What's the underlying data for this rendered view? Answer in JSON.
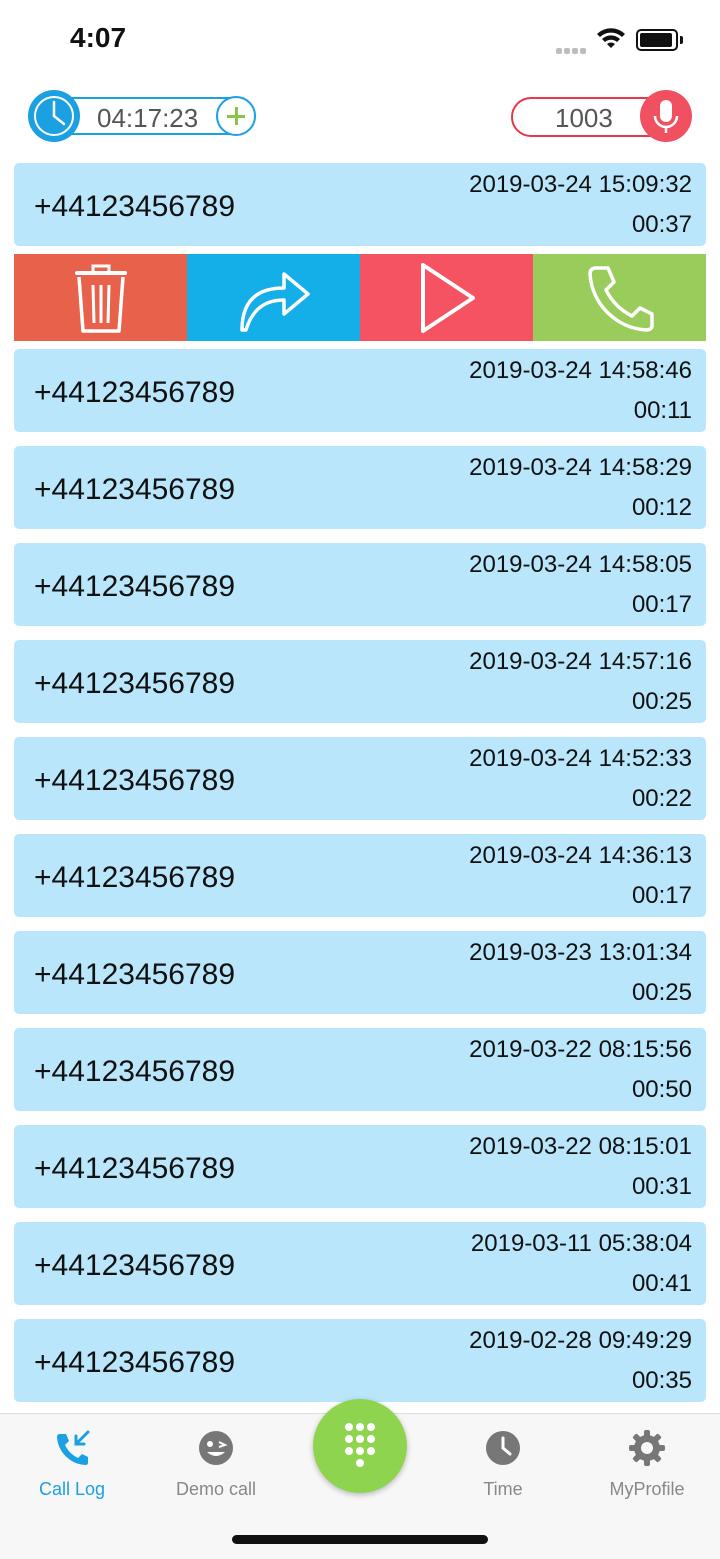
{
  "status_bar": {
    "time": "4:07"
  },
  "header": {
    "balance": "04:17:23",
    "extension": "1003"
  },
  "calls": [
    {
      "number": "+44123456789",
      "datetime": "2019-03-24 15:09:32",
      "duration": "00:37"
    },
    {
      "number": "+44123456789",
      "datetime": "2019-03-24 14:58:46",
      "duration": "00:11"
    },
    {
      "number": "+44123456789",
      "datetime": "2019-03-24 14:58:29",
      "duration": "00:12"
    },
    {
      "number": "+44123456789",
      "datetime": "2019-03-24 14:58:05",
      "duration": "00:17"
    },
    {
      "number": "+44123456789",
      "datetime": "2019-03-24 14:57:16",
      "duration": "00:25"
    },
    {
      "number": "+44123456789",
      "datetime": "2019-03-24 14:52:33",
      "duration": "00:22"
    },
    {
      "number": "+44123456789",
      "datetime": "2019-03-24 14:36:13",
      "duration": "00:17"
    },
    {
      "number": "+44123456789",
      "datetime": "2019-03-23 13:01:34",
      "duration": "00:25"
    },
    {
      "number": "+44123456789",
      "datetime": "2019-03-22 08:15:56",
      "duration": "00:50"
    },
    {
      "number": "+44123456789",
      "datetime": "2019-03-22 08:15:01",
      "duration": "00:31"
    },
    {
      "number": "+44123456789",
      "datetime": "2019-03-11 05:38:04",
      "duration": "00:41"
    },
    {
      "number": "+44123456789",
      "datetime": "2019-02-28 09:49:29",
      "duration": "00:35"
    }
  ],
  "swipe_actions": [
    {
      "icon": "trash-icon",
      "color": "#e8614a"
    },
    {
      "icon": "forward-icon",
      "color": "#14aee8"
    },
    {
      "icon": "play-icon",
      "color": "#f55262"
    },
    {
      "icon": "phone-icon",
      "color": "#99cc5a"
    }
  ],
  "bottom_nav": {
    "items": [
      {
        "label": "Call Log",
        "icon": "call-log-icon",
        "active": true
      },
      {
        "label": "Demo call",
        "icon": "demo-call-icon",
        "active": false
      },
      {
        "label": "Time",
        "icon": "clock-icon",
        "active": false
      },
      {
        "label": "MyProfile",
        "icon": "gear-icon",
        "active": false
      }
    ]
  },
  "colors": {
    "accent_blue": "#1ba0e2",
    "row_bg": "#b9e6fb",
    "red": "#e8364a",
    "green": "#8fd44f"
  }
}
